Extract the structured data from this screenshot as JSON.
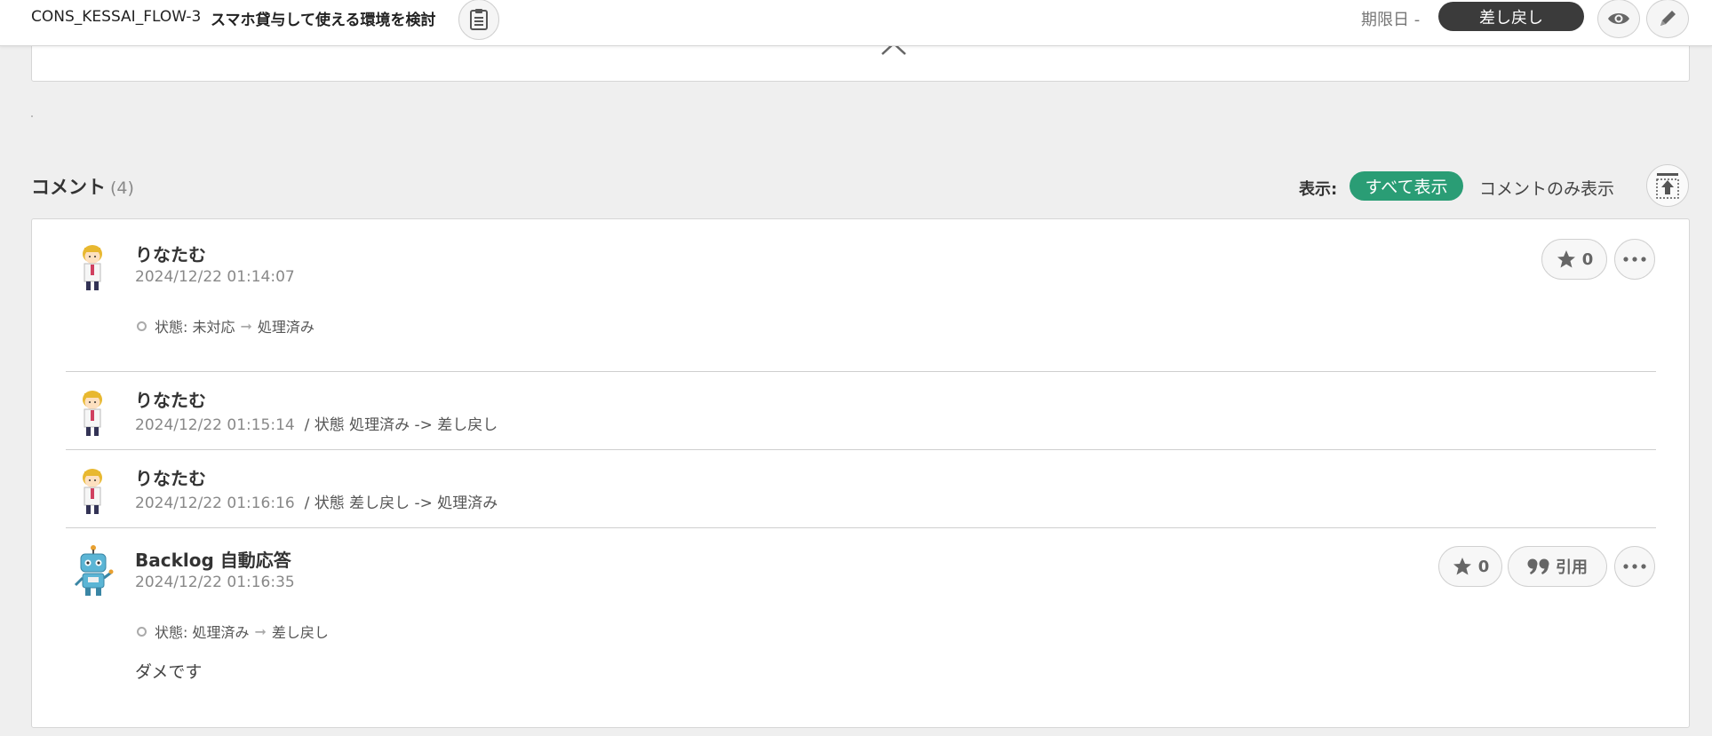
{
  "header": {
    "issue_key": "CONS_KESSAI_FLOW-3",
    "issue_title": "スマホ貸与して使える環境を検討",
    "due_label": "期限日 -",
    "status": "差し戻し"
  },
  "comments_section": {
    "title": "コメント",
    "count": "(4)",
    "display_label": "表示:",
    "filter_all": "すべて表示",
    "filter_comments_only": "コメントのみ表示"
  },
  "comments": [
    {
      "author": "りなたむ",
      "timestamp": "2024/12/22 01:14:07",
      "change_field": "状態: 未対応",
      "change_to": "処理済み",
      "star_count": "0"
    },
    {
      "author": "りなたむ",
      "timestamp": "2024/12/22 01:15:14",
      "inline_change": "/  状態 処理済み -> 差し戻し"
    },
    {
      "author": "りなたむ",
      "timestamp": "2024/12/22 01:16:16",
      "inline_change": "/  状態 差し戻し -> 処理済み"
    },
    {
      "author": "Backlog 自動応答",
      "timestamp": "2024/12/22 01:16:35",
      "change_field": "状態: 処理済み",
      "change_to": "差し戻し",
      "body": "ダメです",
      "star_count": "0",
      "quote_label": "引用"
    }
  ],
  "colors": {
    "accent_green": "#2a9d75",
    "status_dark": "#3b3b3b",
    "background": "#efefef"
  },
  "icons": [
    "clipboard-icon",
    "eye-icon",
    "pencil-icon",
    "chevron-up-icon",
    "scroll-top-icon",
    "star-icon",
    "more-icon",
    "quote-icon",
    "person-avatar",
    "robot-avatar"
  ]
}
